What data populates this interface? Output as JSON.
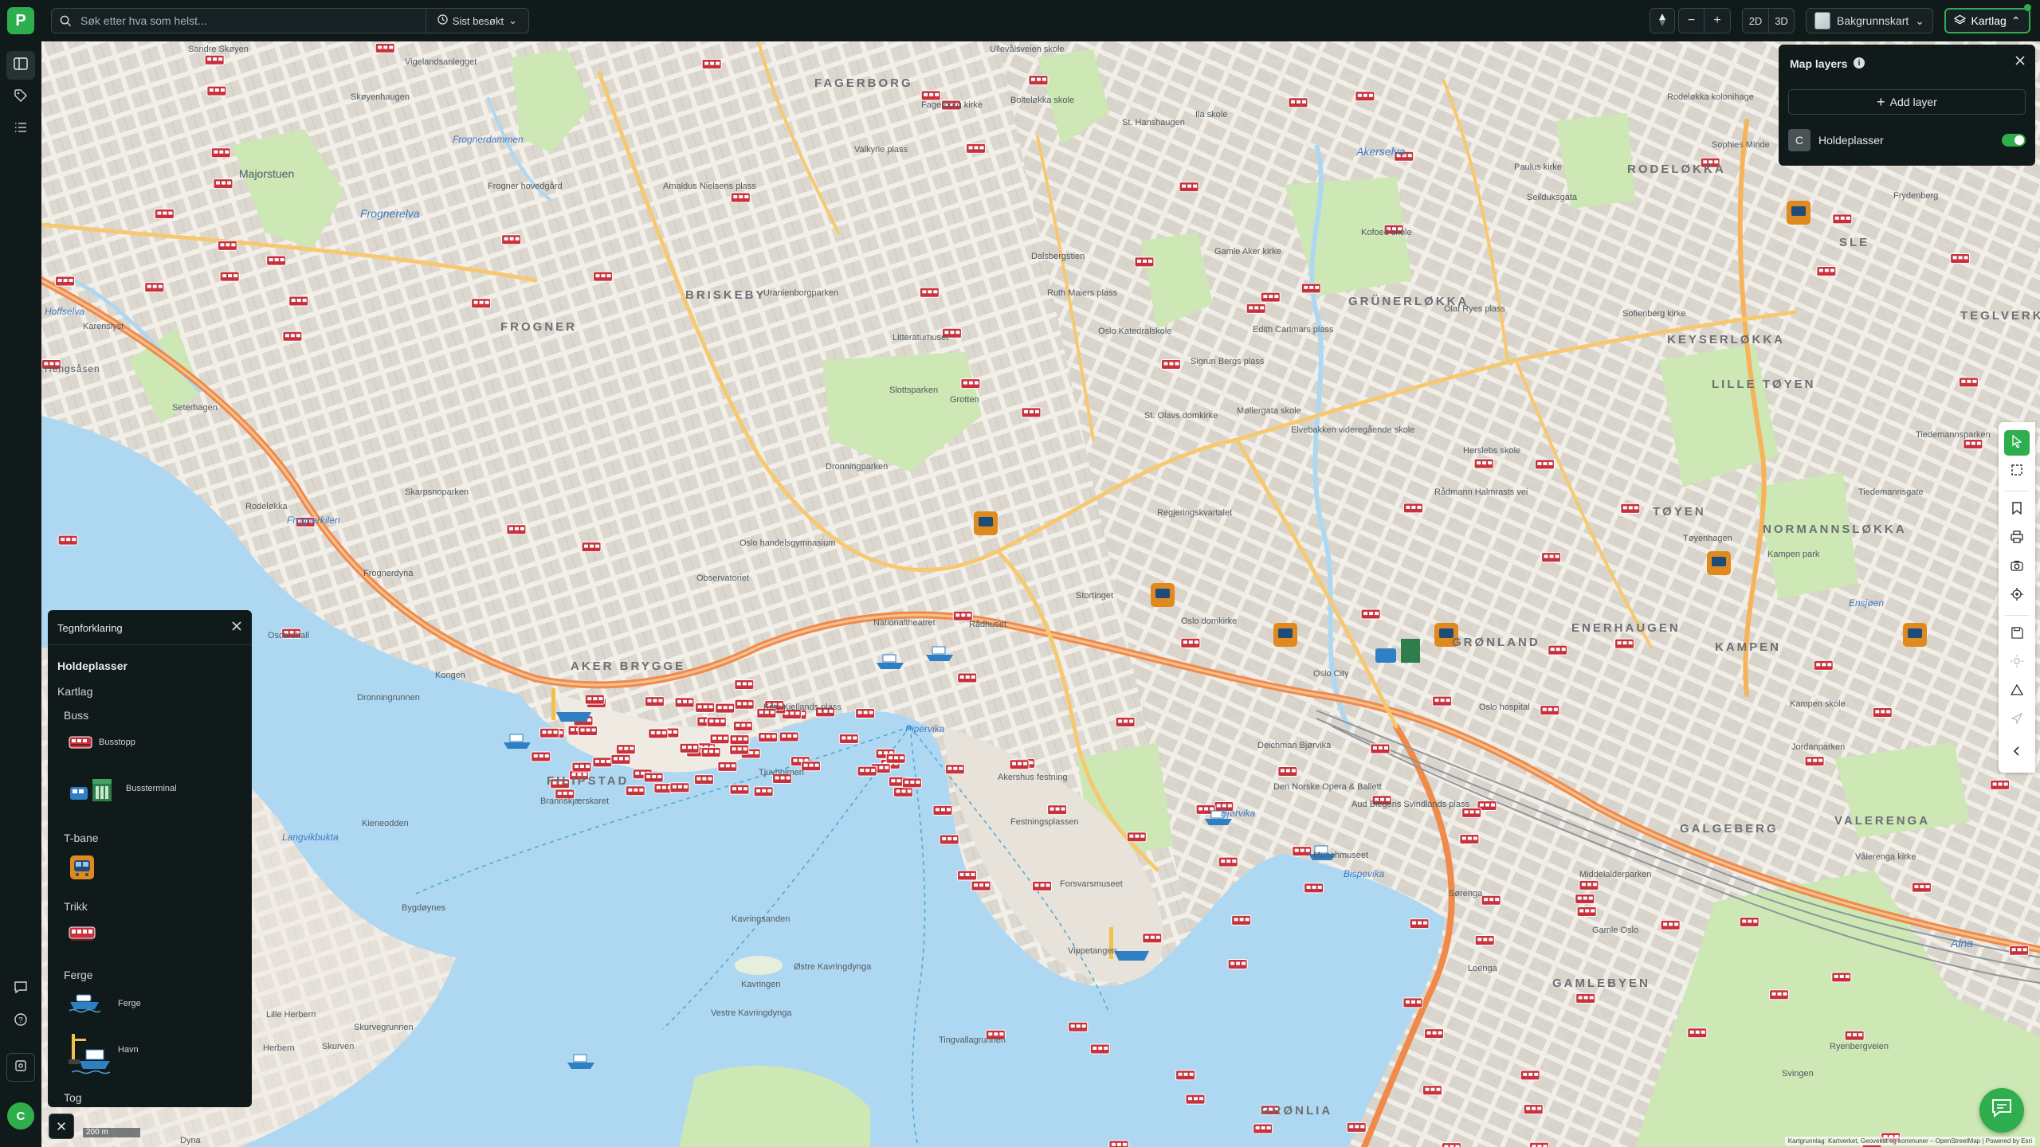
{
  "app": {
    "logo_letter": "P"
  },
  "search": {
    "placeholder": "Søk etter hva som helst...",
    "recent_label": "Sist besøkt"
  },
  "toolbar": {
    "zoom_out": "−",
    "zoom_in": "+",
    "view_2d": "2D",
    "view_3d": "3D",
    "basemap_label": "Bakgrunnskart",
    "layers_label": "Kartlag"
  },
  "user": {
    "avatar_initial": "C"
  },
  "layers_panel": {
    "title": "Map layers",
    "info_icon": "i",
    "add_layer_label": "Add layer",
    "layers": [
      {
        "icon_letter": "C",
        "name": "Holdeplasser",
        "enabled": true
      }
    ]
  },
  "legend": {
    "title": "Tegnforklaring",
    "layer_name": "Holdeplasser",
    "group_name": "Kartlag",
    "categories": [
      {
        "name": "Buss",
        "items": [
          "Busstopp",
          "Bussterminal"
        ]
      },
      {
        "name": "T-bane",
        "items": []
      },
      {
        "name": "Trikk",
        "items": []
      },
      {
        "name": "Ferge",
        "items": [
          "Ferge",
          "Havn"
        ]
      },
      {
        "name": "Tog",
        "items": []
      }
    ]
  },
  "map": {
    "scale_label": "200 m",
    "attribution": "Kartgrunnlag: Kartverket, Geovekst og kommuner – OpenStreetMap | Powered by Esri",
    "districts": [
      "FAGERBORG",
      "RODELØKKA",
      "GRÜNERLØKKA",
      "BRISKEBY",
      "FROGNER",
      "KEYSERLØKKA",
      "LILLE TØYEN",
      "TEGLVERKET",
      "TØYEN",
      "NORMANNSLØKKA",
      "AKER BRYGGE",
      "GRØNLAND",
      "ENERHAUGEN",
      "KAMPEN",
      "FILIPSTAD",
      "VALERENGA",
      "GALGEBERG",
      "GAMLEBYEN",
      "GRØNLIA",
      "SLE"
    ],
    "water_names": [
      "Frognerdammen",
      "Frognerelva",
      "Hoffselva",
      "Frognerkilen",
      "Akerselva",
      "Pipervika",
      "Langvikbukta",
      "Bjørvika",
      "Bispevika",
      "Alna",
      "Ensjøen"
    ],
    "places": [
      "Sandre Skøyen",
      "Vigelandsanlegget",
      "Skøyenhaugen",
      "Majorstuen",
      "Frogner hovedgård",
      "Amaldus Nielsens plass",
      "Valkyrie plass",
      "Fagerborg kirke",
      "Bolteløkka skole",
      "Ullevålsveien skole",
      "St. Hanshaugen",
      "Ila skole",
      "Rodeløkka kolonihage",
      "Sophies Minde",
      "Akerselva",
      "Paulus kirke",
      "Seilduksgata",
      "Kofoed skole",
      "Gamle Aker kirke",
      "Dalsbergstien",
      "Ruth Maiers plass",
      "Oslo Katedralskole",
      "Edith Carlmars plass",
      "Sigrun Bergs plass",
      "Olaf Ryes plass",
      "Sofienberg kirke",
      "Frydenberg",
      "Karenslyst",
      "Hengsåsen",
      "Seterhagen",
      "Rodeløkka",
      "Skarpsnoparken",
      "Uranienborgparken",
      "Litteraturhuset",
      "Slottsparken",
      "Grotten",
      "St. Olavs domkirke",
      "Møllergata skole",
      "Elvebakken videregående skole",
      "Herslebs skole",
      "Rådmann Halmrasts vei",
      "Dronningparken",
      "Oslo handelsgymnasium",
      "Observatoriet",
      "Nationaltheatret",
      "Stortinget",
      "Oslo domkirke",
      "Regjeringskvartalet",
      "Tøyenhagen",
      "Kampen park",
      "Tiedemannsgate",
      "Tiedemannsparken",
      "Frognerdyna",
      "Oscarshall",
      "Kongen",
      "Dronningrunnen",
      "Tjuvholmen",
      "Kitty Kiellands plass",
      "Brannskjærskaret",
      "Rådhuset",
      "Akershus festning",
      "Festningsplassen",
      "Forsvarsmuseet",
      "Vippetangen",
      "Den Norske Opera & Ballett",
      "Aud Blegens Svindlands plass",
      "Kavringsanden",
      "Østre Kavringdynga",
      "Vestre Kavringdynga",
      "Kavringen",
      "Tingvallagrunnen",
      "Lille Herbern",
      "Skurvegrunnen",
      "Herbern",
      "Skurven",
      "Bygdøynes",
      "Kieneodden",
      "Dyna",
      "Kampen skole",
      "Vålerenga kirke",
      "Oslo hospital",
      "Svingen",
      "Ryenbergveien",
      "Jordanparken",
      "Gamle Oslo",
      "Loenga",
      "Sørenga",
      "Middelalderparken",
      "Munchmuseet",
      "Oslo City",
      "Deichman Bjørvika"
    ]
  },
  "colors": {
    "chrome": "#111a1b",
    "accent": "#2fae4e",
    "water": "#aed8f2",
    "park": "#cde7b5",
    "bus_stop": "#c8313b",
    "metro": "#e08a1e",
    "tram": "#6b8fb8",
    "ferry": "#2f7fc4"
  },
  "icons": {
    "search": "search-icon",
    "recent": "clock-icon",
    "compass": "compass-icon",
    "basemap": "basemap-thumbnail-icon",
    "layers": "layers-icon",
    "rail": [
      "map-icon",
      "tag-icon",
      "list-icon"
    ],
    "rail_bottom": [
      "comment-icon",
      "help-icon",
      "settings-icon"
    ],
    "tools": [
      "select-arrow-icon",
      "box-select-icon",
      "bookmark-icon",
      "print-icon",
      "camera-icon",
      "locate-icon",
      "save-icon",
      "sun-icon",
      "measure-icon",
      "navigation-icon",
      "collapse-chevron-icon"
    ]
  }
}
